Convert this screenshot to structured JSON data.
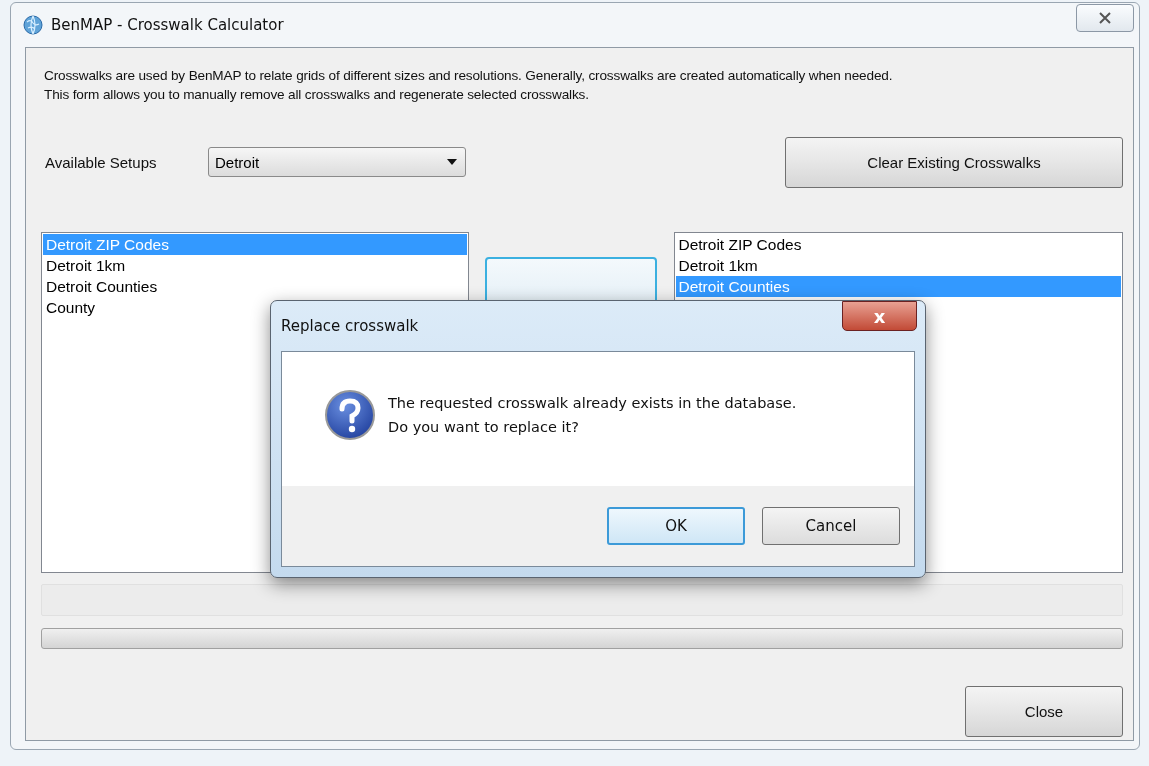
{
  "window": {
    "title": "BenMAP - Crosswalk Calculator"
  },
  "description": "Crosswalks are used by BenMAP to relate grids of different sizes and resolutions. Generally, crosswalks are created automatically when needed.\nThis form allows you to manually remove all crosswalks and regenerate selected crosswalks.",
  "setups": {
    "label": "Available Setups",
    "value": "Detroit"
  },
  "clear_button": "Clear Existing Crosswalks",
  "left_list": [
    {
      "label": "Detroit ZIP Codes",
      "selected": true
    },
    {
      "label": "Detroit 1km",
      "selected": false
    },
    {
      "label": "Detroit Counties",
      "selected": false
    },
    {
      "label": "County",
      "selected": false
    }
  ],
  "right_list": [
    {
      "label": "Detroit ZIP Codes",
      "selected": false
    },
    {
      "label": "Detroit 1km",
      "selected": false
    },
    {
      "label": "Detroit Counties",
      "selected": true
    }
  ],
  "progress": {
    "level": 0
  },
  "close_button": "Close",
  "dialog": {
    "title": "Replace crosswalk",
    "close_glyph": "x",
    "message": "The requested crosswalk already exists in the database.\nDo you want to replace it?",
    "buttons": [
      {
        "label": "OK",
        "default": true
      },
      {
        "label": "Cancel",
        "default": false
      }
    ]
  }
}
